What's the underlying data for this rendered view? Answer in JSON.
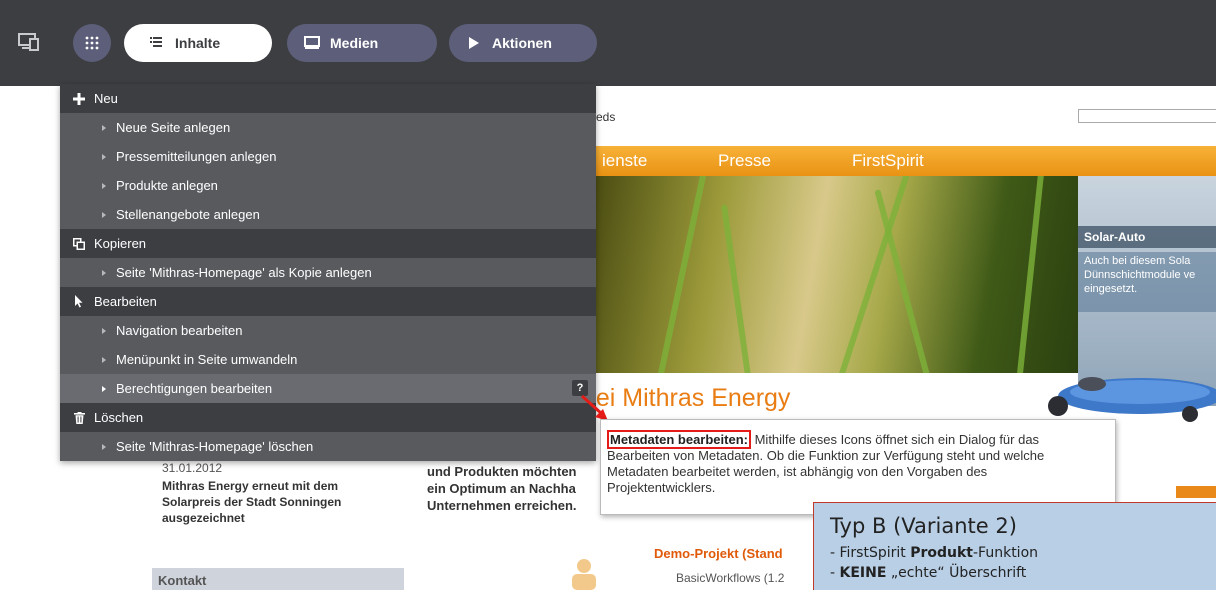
{
  "toolbar": {
    "device_icon": "device-preview-icon",
    "grid_icon": "app-grid-icon",
    "tabs": [
      {
        "label": "Inhalte",
        "icon": "text-lines-icon"
      },
      {
        "label": "Medien",
        "icon": "media-monitor-icon"
      },
      {
        "label": "Aktionen",
        "icon": "play-triangle-icon"
      }
    ]
  },
  "menu": {
    "sections": [
      {
        "label": "Neu",
        "icon": "plus-icon",
        "items": [
          "Neue Seite anlegen",
          "Pressemitteilungen anlegen",
          "Produkte anlegen",
          "Stellenangebote anlegen"
        ]
      },
      {
        "label": "Kopieren",
        "icon": "copy-icon",
        "items": [
          "Seite 'Mithras-Homepage' als Kopie anlegen"
        ]
      },
      {
        "label": "Bearbeiten",
        "icon": "cursor-icon",
        "items": [
          "Navigation bearbeiten",
          "Menüpunkt in Seite umwandeln",
          "Berechtigungen bearbeiten"
        ]
      },
      {
        "label": "Löschen",
        "icon": "trash-icon",
        "items": [
          "Seite 'Mithras-Homepage' löschen"
        ]
      }
    ],
    "help_label": "?"
  },
  "tooltip": {
    "heading": "Metadaten bearbeiten:",
    "line1": " Mithilfe dieses Icons öffnet sich ein Dialog für das",
    "line2": "Bearbeiten von Metadaten. Ob die Funktion zur Verfügung steht und welche",
    "line3": "Metadaten bearbeitet werden, ist abhängig von den Vorgaben des",
    "line4": "Projektentwicklers."
  },
  "annotation": {
    "title": "Typ B (Variante 2)",
    "line1_prefix": "-  FirstSpirit ",
    "line1_bold": "Produkt",
    "line1_suffix": "-Funktion",
    "line2_prefix": "-  ",
    "line2_bold": "KEINE",
    "line2_suffix": " „echte“ Überschrift",
    "border_color": "#c0392b",
    "fill_color": "#b8cfe6"
  },
  "website": {
    "search_suffix": "eds",
    "nav": [
      "ienste",
      "Presse",
      "FirstSpirit"
    ],
    "solar_title": "Solar-Auto",
    "solar_text1": "Auch bei diesem Sola",
    "solar_text2": "Dünnschichtmodule ve",
    "solar_text3": "eingesetzt.",
    "heading": "bei Mithras Energy",
    "date": "31.01.2012",
    "news1": "Mithras Energy erneut mit dem",
    "news2": "Solarpreis der Stadt Sonningen",
    "news3": "ausgezeichnet",
    "intro1": "und Produkten möchten",
    "intro2": "ein Optimum an Nachha",
    "intro3": "Unternehmen erreichen.",
    "demo": "Demo-Projekt (Stand",
    "demo_sub": "BasicWorkflows (1.2",
    "kontakt": "Kontakt",
    "accent_color": "#e97d14"
  }
}
